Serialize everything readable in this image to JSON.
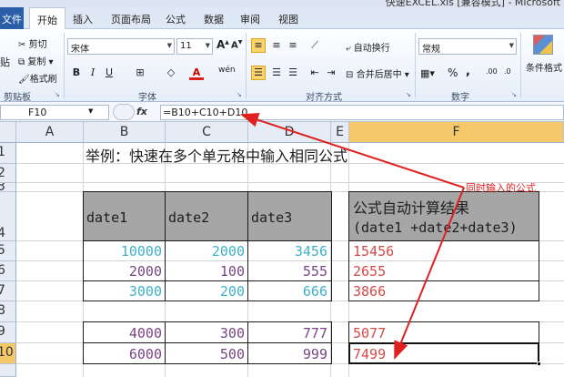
{
  "window": {
    "title": "快速EXCEL.xls [兼容模式] - Microsoft"
  },
  "tabs": [
    {
      "label": "文件"
    },
    {
      "label": "开始"
    },
    {
      "label": "插入"
    },
    {
      "label": "页面布局"
    },
    {
      "label": "公式"
    },
    {
      "label": "数据"
    },
    {
      "label": "审阅"
    },
    {
      "label": "视图"
    }
  ],
  "ribbon": {
    "clipboard": {
      "cut": "剪切",
      "copy": "复制 ▾",
      "format_painter": "格式刷",
      "paste": "贴",
      "label": "剪贴板"
    },
    "font": {
      "name": "宋体",
      "size": "11",
      "label": "字体",
      "bold": "B",
      "italic": "I",
      "underline": "U",
      "grow": "A",
      "shrink": "A",
      "phonetic": "wén"
    },
    "alignment": {
      "wrap": "自动换行",
      "merge": "合并后居中 ▾",
      "label": "对齐方式"
    },
    "number": {
      "format": "常规",
      "percent": "%",
      "comma": ",",
      "inc": ".00",
      "dec": ".0",
      "label": "数字"
    },
    "styles": {
      "conditional": "条件格式"
    }
  },
  "formula_bar": {
    "name_box": "F10",
    "fx": "fx",
    "formula": "=B10+C10+D10"
  },
  "columns": [
    "A",
    "B",
    "C",
    "D",
    "E",
    "F"
  ],
  "rows": [
    "1",
    "2",
    "3",
    "4",
    "5",
    "6",
    "7",
    "8",
    "9",
    "10"
  ],
  "sheet": {
    "title": "举例：快速在多个单元格中输入相同公式",
    "header": {
      "b": "date1",
      "c": "date2",
      "d": "date3",
      "f_line1": "公式自动计算结果",
      "f_line2": "(date1 +date2+date3)"
    },
    "rows": [
      {
        "b": "10000",
        "c": "2000",
        "d": "3456",
        "f": "15456"
      },
      {
        "b": "2000",
        "c": "100",
        "d": "555",
        "f": "2655"
      },
      {
        "b": "3000",
        "c": "200",
        "d": "666",
        "f": "3866"
      },
      {
        "b": "4000",
        "c": "300",
        "d": "777",
        "f": "5077"
      },
      {
        "b": "6000",
        "c": "500",
        "d": "999",
        "f": "7499"
      }
    ]
  },
  "annotation": {
    "text": "同时输入的公式",
    "color": "#e02020"
  }
}
